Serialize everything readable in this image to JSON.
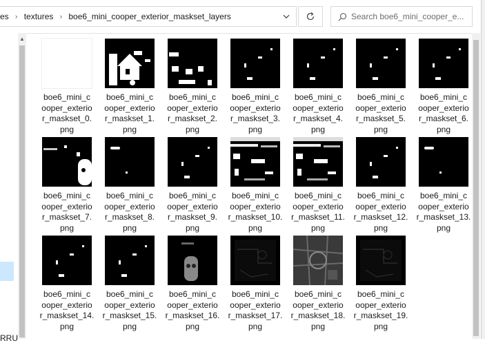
{
  "address": {
    "crumbs": [
      "es",
      "textures",
      "boe6_mini_cooper_exterior_maskset_layers"
    ]
  },
  "search": {
    "placeholder": "Search boe6_mini_cooper_e..."
  },
  "nav": {
    "partial_text": "RRU"
  },
  "files": [
    {
      "name": "boe6_mini_cooper_exterior_maskset_0.png",
      "lines": [
        "boe6_mini_c",
        "ooper_exterio",
        "r_maskset_0.",
        "png"
      ],
      "style": "white"
    },
    {
      "name": "boe6_mini_cooper_exterior_maskset_1.png",
      "lines": [
        "boe6_mini_c",
        "ooper_exterio",
        "r_maskset_1.",
        "png"
      ],
      "style": "house"
    },
    {
      "name": "boe6_mini_cooper_exterior_maskset_2.png",
      "lines": [
        "boe6_mini_c",
        "ooper_exterio",
        "r_maskset_2.",
        "png"
      ],
      "style": "blobs"
    },
    {
      "name": "boe6_mini_cooper_exterior_maskset_3.png",
      "lines": [
        "boe6_mini_c",
        "ooper_exterio",
        "r_maskset_3.",
        "png"
      ],
      "style": "sparse"
    },
    {
      "name": "boe6_mini_cooper_exterior_maskset_4.png",
      "lines": [
        "boe6_mini_c",
        "ooper_exterio",
        "r_maskset_4.",
        "png"
      ],
      "style": "sparse"
    },
    {
      "name": "boe6_mini_cooper_exterior_maskset_5.png",
      "lines": [
        "boe6_mini_c",
        "ooper_exterio",
        "r_maskset_5.",
        "png"
      ],
      "style": "sparse"
    },
    {
      "name": "boe6_mini_cooper_exterior_maskset_6.png",
      "lines": [
        "boe6_mini_c",
        "ooper_exterio",
        "r_maskset_6.",
        "png"
      ],
      "style": "sparse"
    },
    {
      "name": "boe6_mini_cooper_exterior_maskset_7.png",
      "lines": [
        "boe6_mini_c",
        "ooper_exterio",
        "r_maskset_7.",
        "png"
      ],
      "style": "figure"
    },
    {
      "name": "boe6_mini_cooper_exterior_maskset_8.png",
      "lines": [
        "boe6_mini_c",
        "ooper_exterio",
        "r_maskset_8.",
        "png"
      ],
      "style": "dot"
    },
    {
      "name": "boe6_mini_cooper_exterior_maskset_9.png",
      "lines": [
        "boe6_mini_c",
        "ooper_exterio",
        "r_maskset_9.",
        "png"
      ],
      "style": "sparse"
    },
    {
      "name": "boe6_mini_cooper_exterior_maskset_10.png",
      "lines": [
        "boe6_mini_c",
        "ooper_exterio",
        "r_maskset_10.",
        "png"
      ],
      "style": "dense"
    },
    {
      "name": "boe6_mini_cooper_exterior_maskset_11.png",
      "lines": [
        "boe6_mini_c",
        "ooper_exterio",
        "r_maskset_11.",
        "png"
      ],
      "style": "dense"
    },
    {
      "name": "boe6_mini_cooper_exterior_maskset_12.png",
      "lines": [
        "boe6_mini_c",
        "ooper_exterio",
        "r_maskset_12.",
        "png"
      ],
      "style": "sparse"
    },
    {
      "name": "boe6_mini_cooper_exterior_maskset_13.png",
      "lines": [
        "boe6_mini_c",
        "ooper_exterio",
        "r_maskset_13.",
        "png"
      ],
      "style": "dot"
    },
    {
      "name": "boe6_mini_cooper_exterior_maskset_14.png",
      "lines": [
        "boe6_mini_c",
        "ooper_exterio",
        "r_maskset_14.",
        "png"
      ],
      "style": "sparse"
    },
    {
      "name": "boe6_mini_cooper_exterior_maskset_15.png",
      "lines": [
        "boe6_mini_c",
        "ooper_exterio",
        "r_maskset_15.",
        "png"
      ],
      "style": "sparse"
    },
    {
      "name": "boe6_mini_cooper_exterior_maskset_16.png",
      "lines": [
        "boe6_mini_c",
        "ooper_exterio",
        "r_maskset_16.",
        "png"
      ],
      "style": "grayfig"
    },
    {
      "name": "boe6_mini_cooper_exterior_maskset_17.png",
      "lines": [
        "boe6_mini_c",
        "ooper_exterio",
        "r_maskset_17.",
        "png"
      ],
      "style": "dim"
    },
    {
      "name": "boe6_mini_cooper_exterior_maskset_18.png",
      "lines": [
        "boe6_mini_c",
        "ooper_exterio",
        "r_maskset_18.",
        "png"
      ],
      "style": "gray"
    },
    {
      "name": "boe6_mini_cooper_exterior_maskset_19.png",
      "lines": [
        "boe6_mini_c",
        "ooper_exterio",
        "r_maskset_19.",
        "png"
      ],
      "style": "dim"
    }
  ]
}
